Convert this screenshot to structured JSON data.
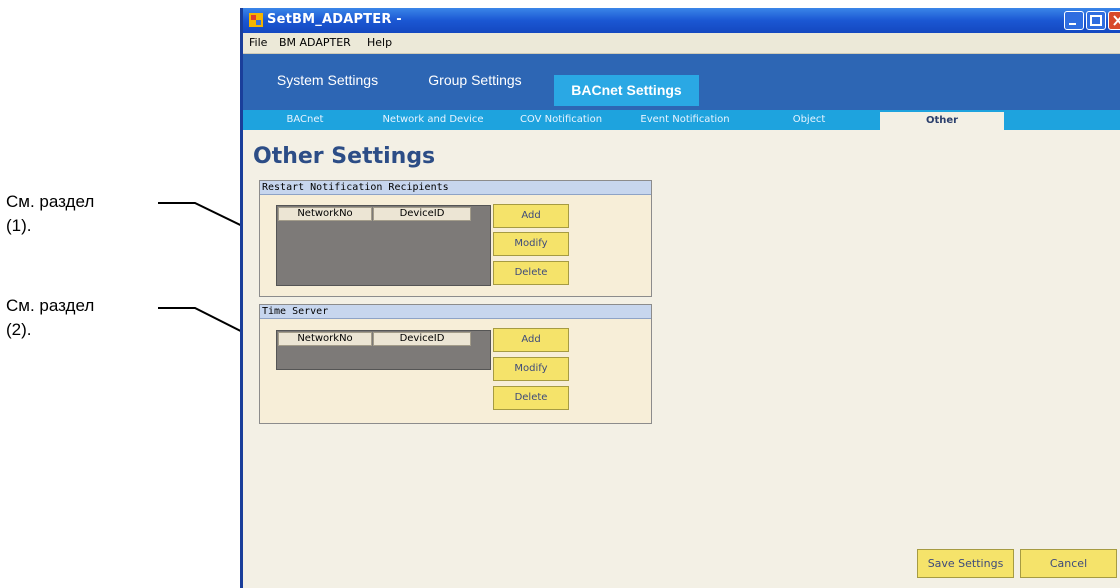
{
  "callouts": [
    {
      "line1": "См. раздел",
      "line2": "(1)."
    },
    {
      "line1": "См. раздел",
      "line2": "(2)."
    }
  ],
  "window": {
    "title": "SetBM_ADAPTER -"
  },
  "menu": {
    "items": [
      "File",
      "BM ADAPTER",
      "Help"
    ]
  },
  "main_tabs": [
    "System Settings",
    "Group Settings",
    "BACnet Settings"
  ],
  "sub_tabs": [
    "BACnet",
    "Network and Device",
    "COV Notification",
    "Event Notification",
    "Object",
    "Other"
  ],
  "page_title": "Other Settings",
  "restart_group": {
    "title": "Restart Notification Recipients",
    "columns": [
      "NetworkNo",
      "DeviceID"
    ],
    "buttons": [
      "Add",
      "Modify",
      "Delete"
    ]
  },
  "time_server_group": {
    "title": "Time Server",
    "columns": [
      "NetworkNo",
      "DeviceID"
    ],
    "buttons": [
      "Add",
      "Modify",
      "Delete"
    ]
  },
  "footer": {
    "save_label": "Save Settings",
    "cancel_label": "Cancel"
  }
}
